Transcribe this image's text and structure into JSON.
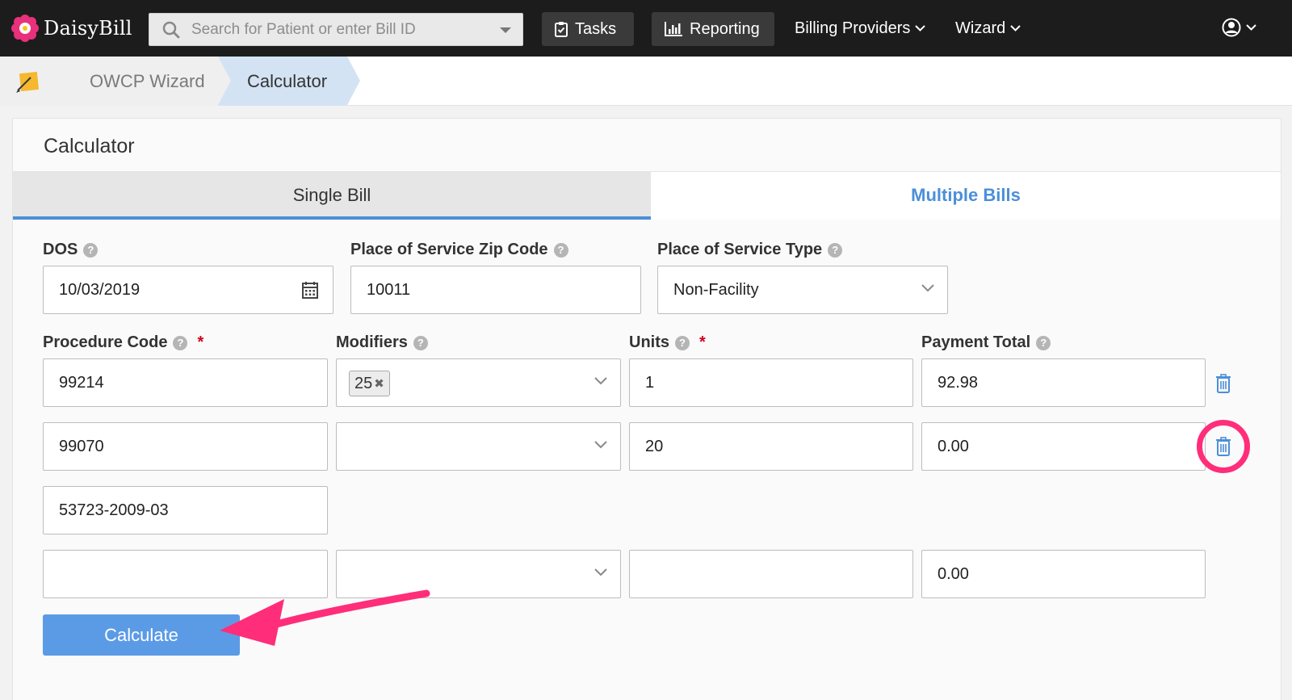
{
  "app": {
    "name": "DaisyBill"
  },
  "search": {
    "placeholder": "Search for Patient or enter Bill ID"
  },
  "nav": {
    "tasks": "Tasks",
    "reporting": "Reporting",
    "billing_providers": "Billing Providers",
    "wizard": "Wizard"
  },
  "breadcrumb": {
    "items": [
      "OWCP Wizard",
      "Calculator"
    ]
  },
  "panel": {
    "title": "Calculator"
  },
  "tabs": {
    "single": "Single Bill",
    "multiple": "Multiple Bills",
    "active": "Single Bill"
  },
  "form": {
    "dos": {
      "label": "DOS",
      "value": "10/03/2019"
    },
    "zip": {
      "label": "Place of Service Zip Code",
      "value": "10011"
    },
    "pos_type": {
      "label": "Place of Service Type",
      "value": "Non-Facility"
    },
    "columns": {
      "procedure_code": "Procedure Code",
      "modifiers": "Modifiers",
      "units": "Units",
      "payment_total": "Payment Total"
    },
    "rows": [
      {
        "procedure_code": "99214",
        "modifier": "25",
        "units": "1",
        "payment_total": "92.98"
      },
      {
        "procedure_code": "99070",
        "modifier": "",
        "units": "20",
        "payment_total": "0.00",
        "ndc": "53723-2009-03"
      },
      {
        "procedure_code": "",
        "modifier": "",
        "units": "",
        "payment_total": "0.00"
      }
    ],
    "calculate_label": "Calculate"
  },
  "colors": {
    "nav_bg": "#1c1c1c",
    "accent": "#4b8fd9",
    "button": "#5b9be6",
    "annotation": "#ff2d7a",
    "required": "#d0021b"
  }
}
